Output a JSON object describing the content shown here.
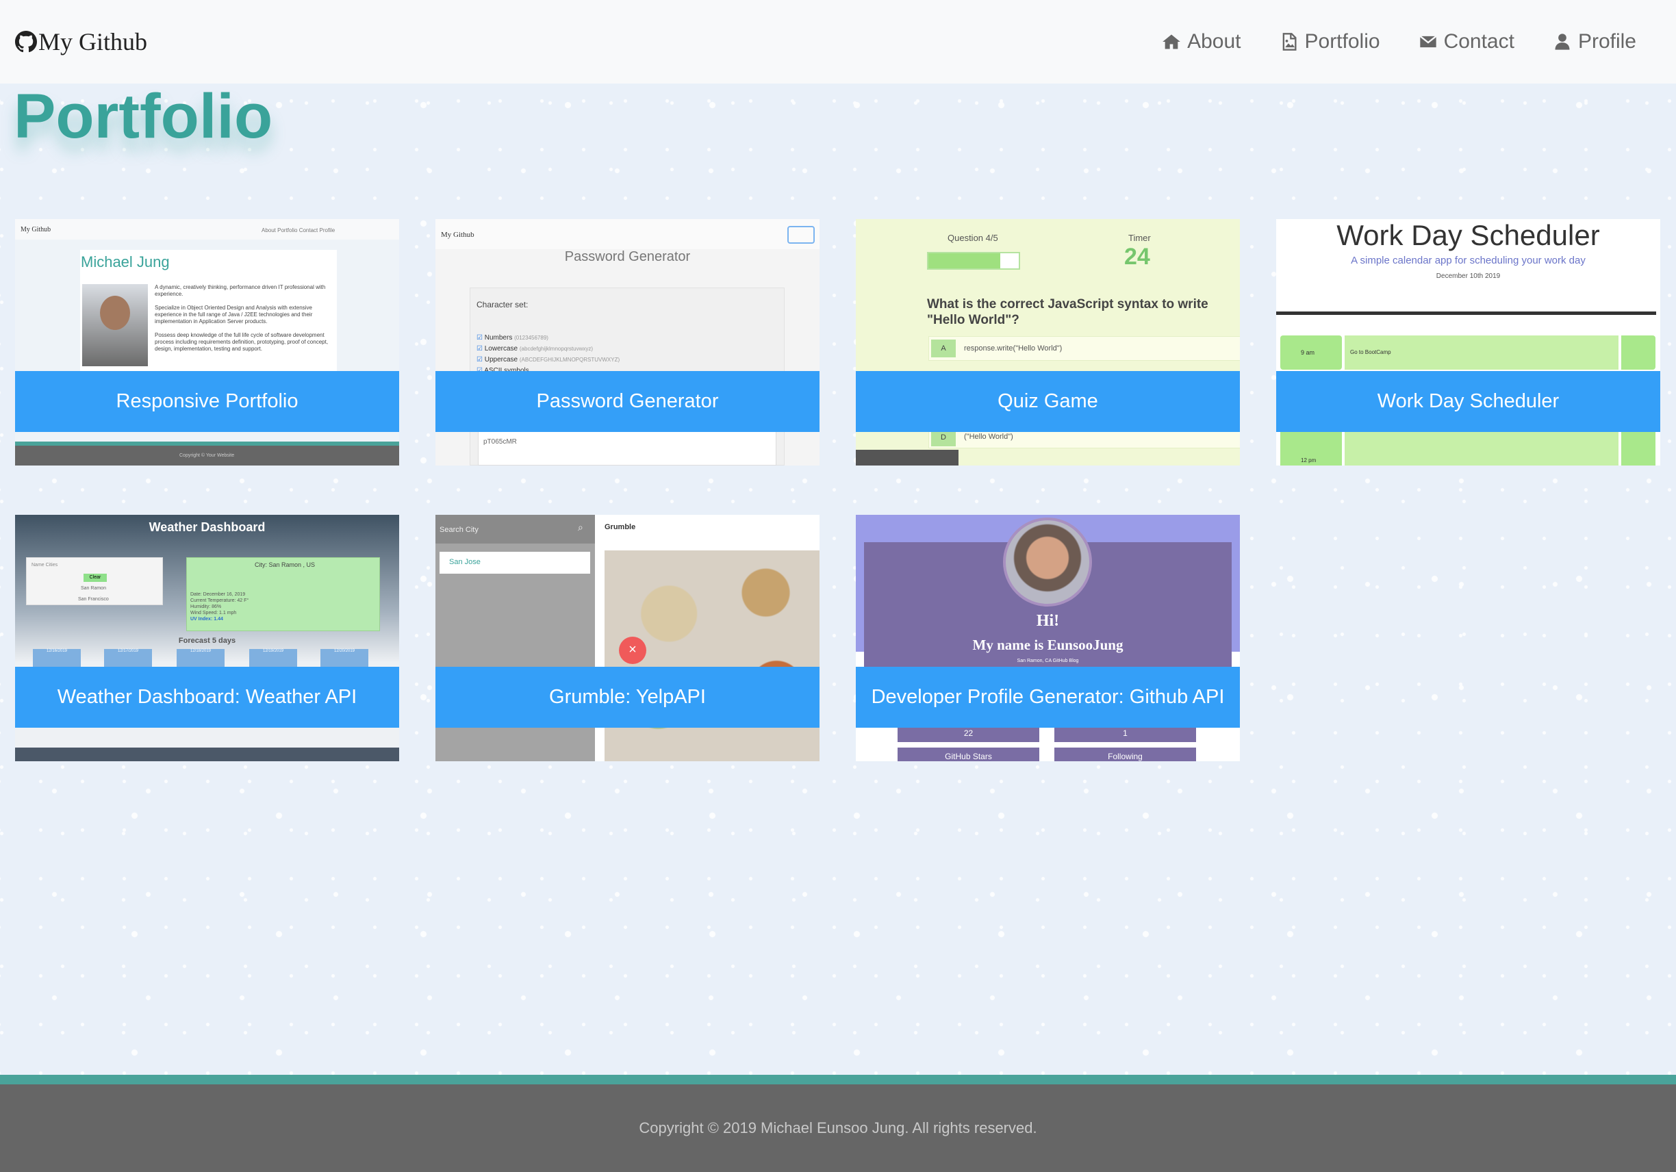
{
  "brand": {
    "text": "My Github"
  },
  "nav": [
    {
      "label": "About",
      "icon": "home-icon"
    },
    {
      "label": "Portfolio",
      "icon": "image-file-icon"
    },
    {
      "label": "Contact",
      "icon": "envelope-icon"
    },
    {
      "label": "Profile",
      "icon": "user-icon"
    }
  ],
  "page": {
    "title": "Portfolio"
  },
  "projects": [
    {
      "label": "Responsive Portfolio"
    },
    {
      "label": "Password Generator"
    },
    {
      "label": "Quiz Game"
    },
    {
      "label": "Work Day Scheduler"
    },
    {
      "label": "Weather Dashboard: Weather API"
    },
    {
      "label": "Grumble: YelpAPI"
    },
    {
      "label": "Developer Profile Generator: Github API"
    }
  ],
  "thumbs": {
    "portfolio": {
      "brand": "My Github",
      "nav": "About   Portfolio   Contact   Profile",
      "name": "Michael Jung",
      "bio1": "A dynamic, creatively thinking, performance driven IT professional with experience.",
      "bio2": "Specialize in Object Oriented Design and Analysis with extensive experience in the full range of Java / J2EE technologies and their implementation in Application Server products.",
      "bio3": "Possess deep knowledge of the full life cycle of software development process including requirements definition, prototyping, proof of concept, design, implementation, testing and support.",
      "footer": "Copyright © Your Website"
    },
    "password": {
      "brand": "My Github",
      "title": "Password Generator",
      "charset": "Character set:",
      "opt1": "Numbers",
      "opt1sub": "(0123456789)",
      "opt2": "Lowercase",
      "opt2sub": "(abcdefghijklmnopqrstuvwxyz)",
      "opt3": "Uppercase",
      "opt3sub": "(ABCDEFGHIJKLMNOPQRSTUVWXYZ)",
      "opt4": "ASCII symbols",
      "result": "pT065cMR"
    },
    "quiz": {
      "question_label": "Question 4/5",
      "timer_label": "Timer",
      "timer_value": "24",
      "question": "What is the correct JavaScript syntax to write \"Hello World\"?",
      "a_key": "A",
      "a_text": "response.write(\"Hello World\")",
      "d_key": "D",
      "d_text": "(\"Hello World\")"
    },
    "scheduler": {
      "title": "Work Day Scheduler",
      "subtitle": "A simple calendar app for scheduling your work day",
      "date": "December 10th 2019",
      "hour": "9 am",
      "task": "Go to BootCamp",
      "hour2": "12 pm"
    },
    "weather": {
      "title": "Weather Dashboard",
      "search": "Name Cities",
      "btn": "Clear",
      "city1": "San Ramon",
      "city2": "San Francisco",
      "current": "City: San Ramon , US",
      "d1": "Date: December 16, 2019",
      "d2": "Current Temperature: 42 F°",
      "d3": "Humidity: 86%",
      "d4": "Wind Speed: 1.1 mph",
      "d5": "UV Index: 1.44",
      "forecast": "Forecast 5 days",
      "fd1": "12/16/2019",
      "fd2": "12/17/2019",
      "fd3": "12/18/2019",
      "fd4": "12/19/2019",
      "fd5": "12/20/2019"
    },
    "grumble": {
      "search": "Search City",
      "city": "San Jose",
      "app": "Grumble"
    },
    "devprofile": {
      "hi": "Hi!",
      "name": "My name is EunsooJung",
      "meta": "San Ramon, CA   GitHub   Blog",
      "stat1": "22",
      "stat2": "1",
      "stat3": "GitHub Stars",
      "stat4": "Following"
    }
  },
  "footer": {
    "copyright": "Copyright © 2019 Michael Eunsoo Jung. All rights reserved."
  },
  "colors": {
    "accent": "#3aa39a",
    "card_label_bg": "#349ff8",
    "footer_bg": "#666666",
    "navbar_bg": "#f8f9fa"
  }
}
